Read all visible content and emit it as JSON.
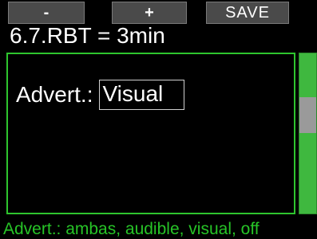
{
  "softkeys": {
    "minus": "-",
    "plus": "+",
    "save": "SAVE"
  },
  "title": "6.7.RBT = 3min",
  "setting": {
    "label": "Advert.:",
    "value": "Visual"
  },
  "scrollbar": {
    "thumb_position": 0.35
  },
  "footer": "Advert.: ambas, audible, visual, off",
  "colors": {
    "accent_green": "#2ec52e",
    "background": "#000000",
    "text": "#ffffff"
  }
}
